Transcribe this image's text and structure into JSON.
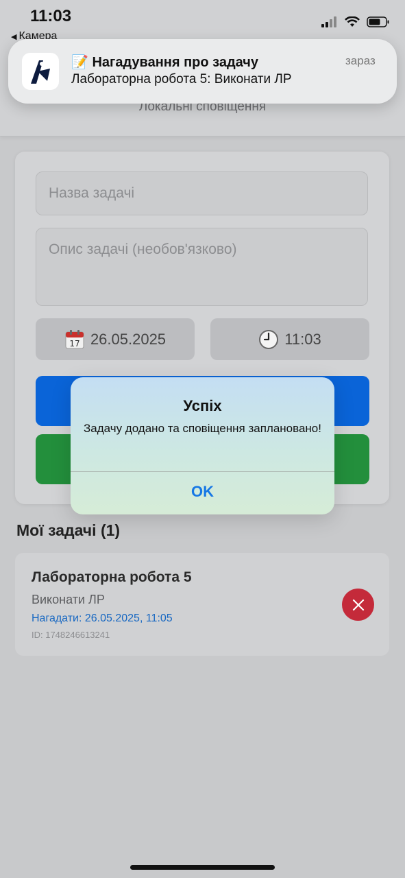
{
  "status_bar": {
    "time": "11:03",
    "back_label": "Камера"
  },
  "header": {
    "subtitle": "Локальні сповіщення"
  },
  "form": {
    "title_placeholder": "Назва задачі",
    "description_placeholder": "Опис задачі (необов'язково)",
    "date_value": "26.05.2025",
    "time_value": "11:03",
    "icons": {
      "calendar": "calendar-icon",
      "clock": "clock-icon"
    }
  },
  "tasks": {
    "section_title": "Мої задачі (1)",
    "items": [
      {
        "title": "Лабораторна робота 5",
        "description": "Виконати ЛР",
        "reminder": "Нагадати: 26.05.2025, 11:05",
        "id_text": "ID: 1748246613241"
      }
    ]
  },
  "notification": {
    "title": "📝 Нагадування про задачу",
    "body": "Лабораторна робота 5: Виконати ЛР",
    "time": "зараз"
  },
  "alert": {
    "title": "Успіх",
    "message": "Задачу додано та сповіщення заплановано!",
    "ok_label": "OK"
  },
  "colors": {
    "primary_button": "#0a64d8",
    "secondary_button": "#238f3c",
    "delete_button": "#c42a3a",
    "link_blue": "#1677e5"
  }
}
